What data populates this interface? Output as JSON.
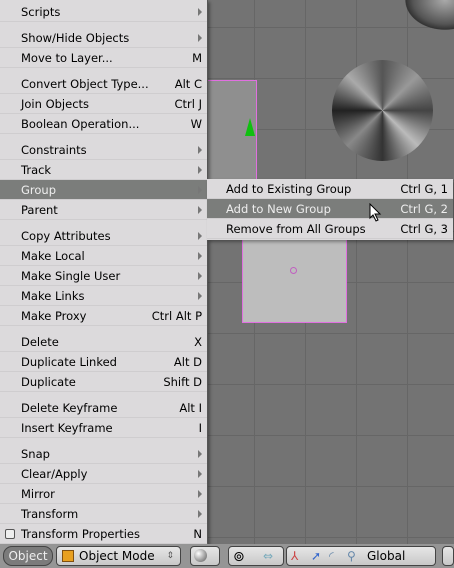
{
  "menu": {
    "items": [
      {
        "label": "Scripts",
        "submenu": true
      },
      {
        "label": "Show/Hide Objects",
        "submenu": true
      },
      {
        "label": "Move to Layer...",
        "shortcut": "M"
      },
      {
        "label": "Convert Object Type...",
        "shortcut": "Alt C"
      },
      {
        "label": "Join Objects",
        "shortcut": "Ctrl J"
      },
      {
        "label": "Boolean Operation...",
        "shortcut": "W"
      },
      {
        "label": "Constraints",
        "submenu": true
      },
      {
        "label": "Track",
        "submenu": true
      },
      {
        "label": "Group",
        "submenu": true,
        "highlighted": true
      },
      {
        "label": "Parent",
        "submenu": true
      },
      {
        "label": "Copy Attributes",
        "submenu": true
      },
      {
        "label": "Make Local",
        "submenu": true
      },
      {
        "label": "Make Single User",
        "submenu": true
      },
      {
        "label": "Make Links",
        "submenu": true
      },
      {
        "label": "Make Proxy",
        "shortcut": "Ctrl Alt P"
      },
      {
        "label": "Delete",
        "shortcut": "X"
      },
      {
        "label": "Duplicate Linked",
        "shortcut": "Alt D"
      },
      {
        "label": "Duplicate",
        "shortcut": "Shift D"
      },
      {
        "label": "Delete Keyframe",
        "shortcut": "Alt I"
      },
      {
        "label": "Insert Keyframe",
        "shortcut": "I"
      },
      {
        "label": "Snap",
        "submenu": true
      },
      {
        "label": "Clear/Apply",
        "submenu": true
      },
      {
        "label": "Mirror",
        "submenu": true
      },
      {
        "label": "Transform",
        "submenu": true
      },
      {
        "label": "Transform Properties",
        "shortcut": "N",
        "checkbox": false
      }
    ]
  },
  "submenu": {
    "items": [
      {
        "label": "Add to Existing Group",
        "shortcut": "Ctrl G, 1"
      },
      {
        "label": "Add to New Group",
        "shortcut": "Ctrl G, 2",
        "highlighted": true
      },
      {
        "label": "Remove from All Groups",
        "shortcut": "Ctrl G, 3"
      }
    ]
  },
  "header": {
    "menu_label": "Object",
    "mode": "Object Mode",
    "orientation": "Global"
  },
  "colors": {
    "highlight": "#7b7d7b",
    "menu_bg": "#dcdadc",
    "selection_outline": "#e070e0"
  }
}
